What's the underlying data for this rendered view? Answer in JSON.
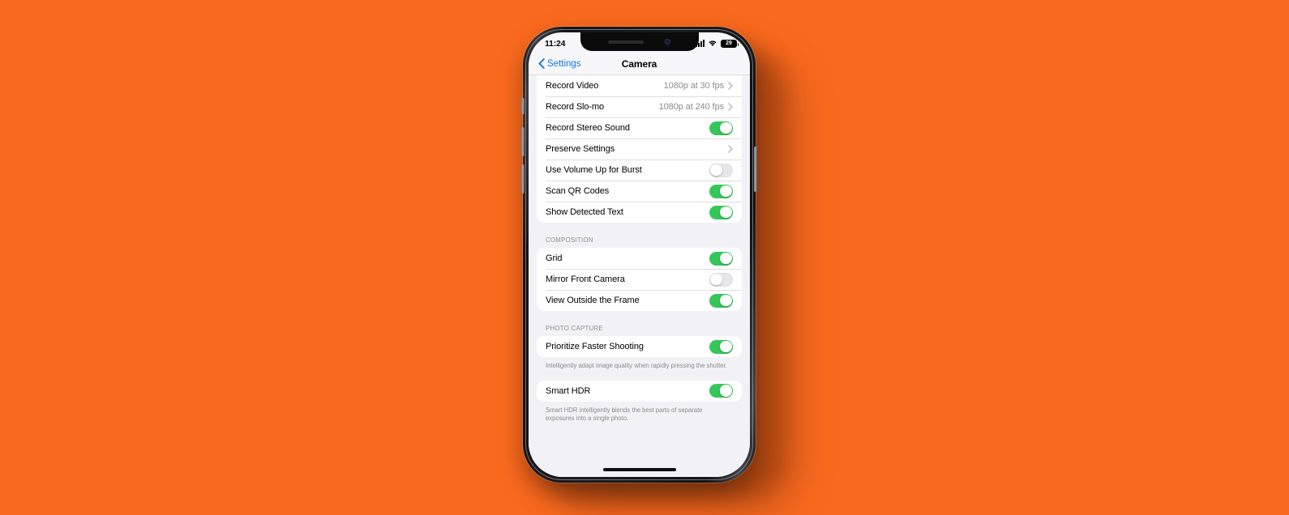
{
  "background": {
    "color": "#FA6A1E"
  },
  "device": {
    "frame_color": "#1b1b1e",
    "buttons": [
      "mute-switch",
      "volume-up",
      "volume-down",
      "power-button"
    ]
  },
  "status_bar": {
    "time": "11:24",
    "signal_icon": "cellular-bars-icon",
    "wifi_icon": "wifi-icon",
    "battery_icon": "battery-icon",
    "battery_level": "29"
  },
  "nav_bar": {
    "back_label": "Settings",
    "back_icon": "chevron-left-icon",
    "title": "Camera"
  },
  "groups": [
    {
      "id": "capture-group",
      "header": "",
      "footnote": "",
      "rows": [
        {
          "label": "Record Video",
          "type": "value",
          "value": "1080p at 30 fps"
        },
        {
          "label": "Record Slo-mo",
          "type": "value",
          "value": "1080p at 240 fps"
        },
        {
          "label": "Record Stereo Sound",
          "type": "toggle",
          "state": "on"
        },
        {
          "label": "Preserve Settings",
          "type": "disclosure",
          "value": ""
        },
        {
          "label": "Use Volume Up for Burst",
          "type": "toggle",
          "state": "off"
        },
        {
          "label": "Scan QR Codes",
          "type": "toggle",
          "state": "on"
        },
        {
          "label": "Show Detected Text",
          "type": "toggle",
          "state": "on"
        }
      ]
    },
    {
      "id": "composition-group",
      "header": "COMPOSITION",
      "footnote": "",
      "rows": [
        {
          "label": "Grid",
          "type": "toggle",
          "state": "on"
        },
        {
          "label": "Mirror Front Camera",
          "type": "toggle",
          "state": "off"
        },
        {
          "label": "View Outside the Frame",
          "type": "toggle",
          "state": "on"
        }
      ]
    },
    {
      "id": "photo-capture-group",
      "header": "PHOTO CAPTURE",
      "footnote": "Intelligently adapt image quality when rapidly pressing the shutter.",
      "rows": [
        {
          "label": "Prioritize Faster Shooting",
          "type": "toggle",
          "state": "on"
        }
      ]
    },
    {
      "id": "smart-hdr-group",
      "header": "",
      "footnote": "Smart HDR intelligently blends the best parts of separate exposures into a single photo.",
      "rows": [
        {
          "label": "Smart HDR",
          "type": "toggle",
          "state": "on"
        }
      ]
    }
  ],
  "home_indicator": {
    "name": "home-indicator"
  },
  "colors": {
    "accent_blue": "#1277E2",
    "toggle_on": "#34C759",
    "toggle_off": "#E6E5EA",
    "list_background": "#F2F1F6",
    "row_background": "#FFFFFF",
    "secondary_text": "#8C8C91"
  }
}
